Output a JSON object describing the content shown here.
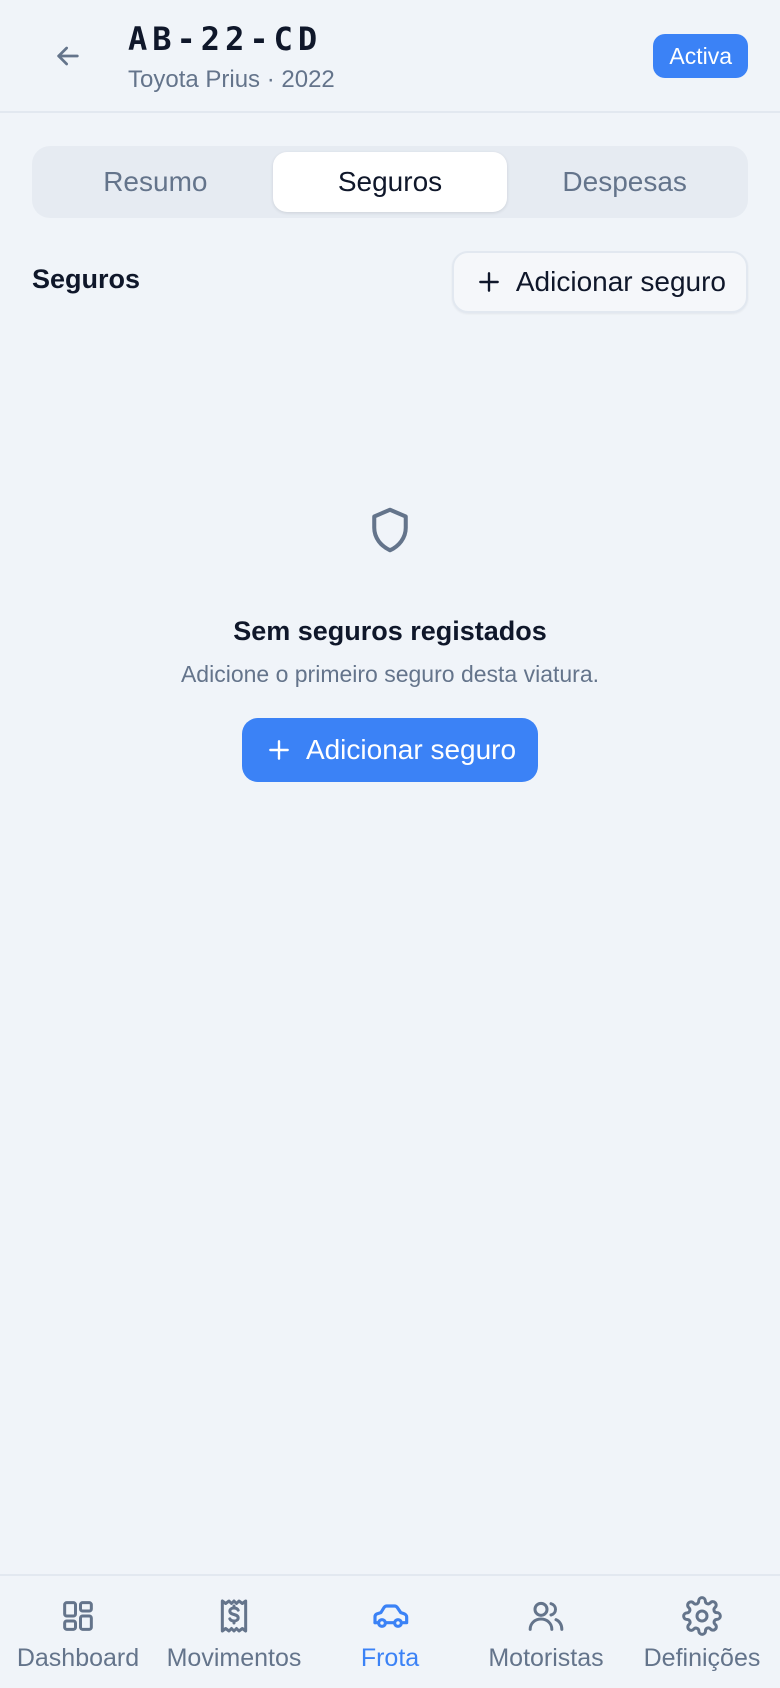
{
  "header": {
    "plate": "AB-22-CD",
    "subtitle": "Toyota Prius · 2022",
    "status": "Activa",
    "back_icon": "arrow-left-icon"
  },
  "tabs": [
    {
      "label": "Resumo",
      "active": false
    },
    {
      "label": "Seguros",
      "active": true
    },
    {
      "label": "Despesas",
      "active": false
    }
  ],
  "section": {
    "title": "Seguros",
    "add_label": "Adicionar seguro"
  },
  "empty_state": {
    "icon": "shield-icon",
    "title": "Sem seguros registados",
    "description": "Adicione o primeiro seguro desta viatura.",
    "button_label": "Adicionar seguro"
  },
  "nav": {
    "items": [
      {
        "label": "Dashboard",
        "icon": "dashboard-icon",
        "active": false
      },
      {
        "label": "Movimentos",
        "icon": "receipt-dollar-icon",
        "active": false
      },
      {
        "label": "Frota",
        "icon": "car-icon",
        "active": true
      },
      {
        "label": "Motoristas",
        "icon": "users-icon",
        "active": false
      },
      {
        "label": "Definições",
        "icon": "gear-icon",
        "active": false
      }
    ]
  },
  "colors": {
    "accent": "#3b82f6",
    "background": "#f0f4f9",
    "text": "#0f172a",
    "muted": "#64748b"
  }
}
